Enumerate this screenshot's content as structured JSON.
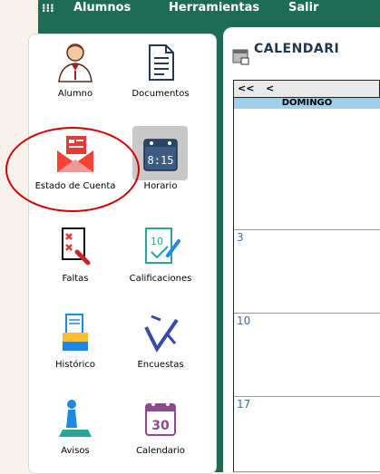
{
  "menu": {
    "items": [
      {
        "label": "Alumnos"
      },
      {
        "label": "Herramientas"
      },
      {
        "label": "Salir"
      }
    ]
  },
  "sidebar": {
    "tiles": [
      {
        "label": "Alumno",
        "icon": "student-icon"
      },
      {
        "label": "Documentos",
        "icon": "document-icon"
      },
      {
        "label": "Estado de Cuenta",
        "icon": "envelope-icon"
      },
      {
        "label": "Horario",
        "icon": "schedule-clock-icon"
      },
      {
        "label": "Faltas",
        "icon": "absences-icon"
      },
      {
        "label": "Calificaciones",
        "icon": "grades-icon"
      },
      {
        "label": "Histórico",
        "icon": "history-icon"
      },
      {
        "label": "Encuestas",
        "icon": "survey-icon"
      },
      {
        "label": "Avisos",
        "icon": "notice-icon"
      },
      {
        "label": "Calendario",
        "icon": "calendar-icon"
      }
    ]
  },
  "calendar": {
    "title": "CALENDARI",
    "nav": {
      "first": "<<",
      "prev": "<"
    },
    "day_header": "DOMINGO",
    "day_numbers": [
      "3",
      "10",
      "17"
    ]
  },
  "colors": {
    "topbar": "#1e6b56",
    "accent_red": "#d10000",
    "day_header_bg": "#9fd0e7",
    "link_blue": "#3a6ea5"
  }
}
